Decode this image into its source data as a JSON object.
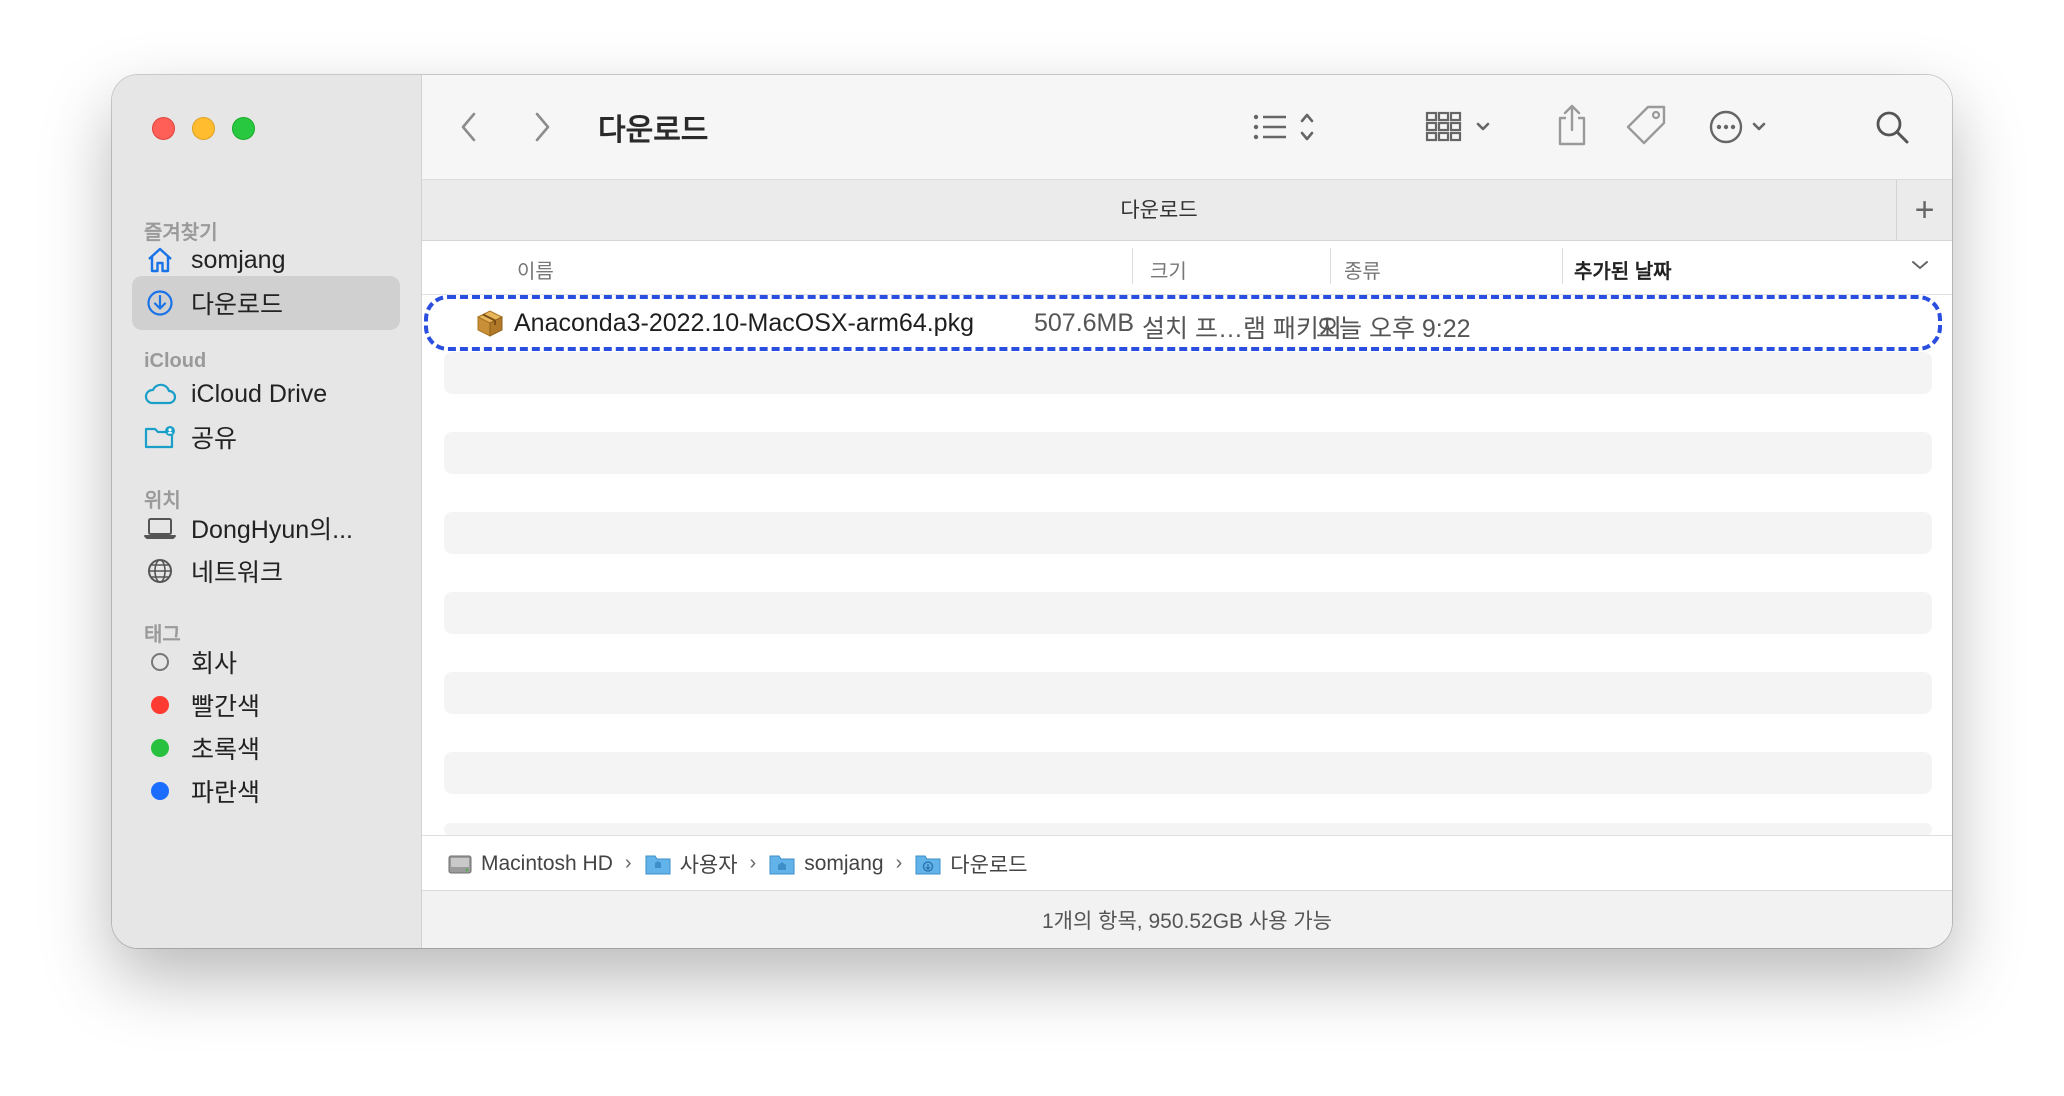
{
  "window": {
    "title": "다운로드"
  },
  "sidebar": {
    "favorites_label": "즐겨찾기",
    "favorites": [
      {
        "label": "somjang",
        "icon": "house-icon"
      },
      {
        "label": "다운로드",
        "icon": "download-circle-icon",
        "active": true
      }
    ],
    "icloud_label": "iCloud",
    "icloud": [
      {
        "label": "iCloud Drive",
        "icon": "cloud-icon"
      },
      {
        "label": "공유",
        "icon": "shared-folder-icon"
      }
    ],
    "locations_label": "위치",
    "locations": [
      {
        "label": "DongHyun의...",
        "icon": "laptop-icon"
      },
      {
        "label": "네트워크",
        "icon": "globe-icon"
      }
    ],
    "tags_label": "태그",
    "tags": [
      {
        "label": "회사",
        "color": "#ffffff"
      },
      {
        "label": "빨간색",
        "color": "#fe3b30"
      },
      {
        "label": "초록색",
        "color": "#27c13f"
      },
      {
        "label": "파란색",
        "color": "#1a6dff"
      }
    ]
  },
  "tab": {
    "label": "다운로드"
  },
  "columns": {
    "name": "이름",
    "size": "크기",
    "kind": "종류",
    "date_added": "추가된 날짜"
  },
  "files": [
    {
      "name": "Anaconda3-2022.10-MacOSX-arm64.pkg",
      "size": "507.6MB",
      "kind": "설치 프…램 패키지",
      "date_added": "오늘 오후 9:22",
      "icon": "package-icon"
    }
  ],
  "pathbar": [
    {
      "label": "Macintosh HD",
      "icon": "disk-icon"
    },
    {
      "label": "사용자",
      "icon": "folder-icon"
    },
    {
      "label": "somjang",
      "icon": "home-folder-icon"
    },
    {
      "label": "다운로드",
      "icon": "downloads-folder-icon"
    }
  ],
  "status": "1개의 항목, 950.52GB 사용 가능",
  "colors": {
    "highlight": "#2a4fe0",
    "accent": "#1a73e8"
  }
}
